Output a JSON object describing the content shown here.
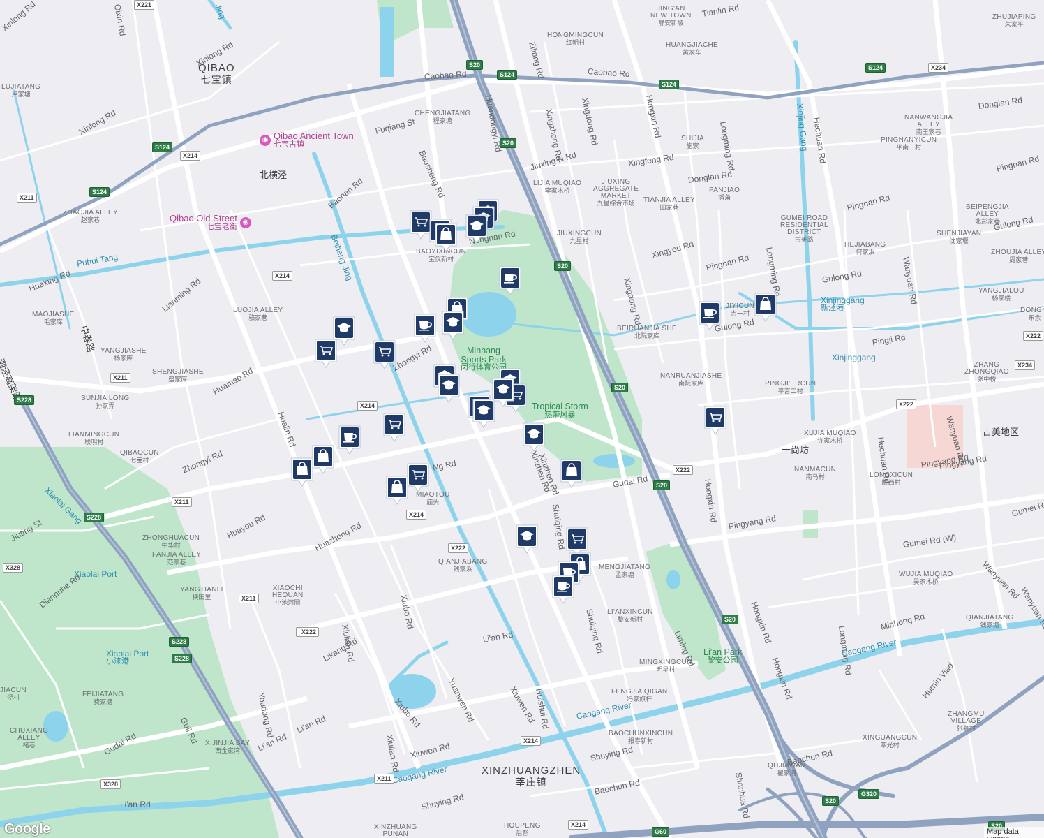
{
  "map": {
    "attribution": "Map data ©2025",
    "logo": "Google",
    "colors": {
      "background": "#eeeef2",
      "water": "#8ed3ec",
      "park": "#bfe6cb",
      "road": "#ffffff",
      "highway": "#8fa3c0",
      "pin": "#1f3a66",
      "poi": "#d65bbf"
    }
  },
  "towns": [
    {
      "id": "qibao",
      "en": "QIBAO",
      "zh": "七宝镇"
    },
    {
      "id": "xinzhuang",
      "en": "XINZHUANGZHEN",
      "zh": "莘庄镇"
    }
  ],
  "places": [
    {
      "id": "jingan",
      "en": "JING'AN",
      "en2": "NEW TOWN",
      "zh": "静安新城"
    },
    {
      "id": "hongmingcun",
      "en": "HONGMINGCUN",
      "zh": "红明村"
    },
    {
      "id": "huangjiache",
      "en": "HUANGJIACHE",
      "zh": "黄家车"
    },
    {
      "id": "zhujiaping",
      "en": "ZHUJIAPING",
      "zh": "朱家平"
    },
    {
      "id": "lujiatang",
      "en": "LUJIATANG",
      "zh": "卢家塘"
    },
    {
      "id": "chengjiatang",
      "en": "CHENGJIATANG",
      "zh": "程家塘"
    },
    {
      "id": "shijia",
      "en": "SHIJIA",
      "zh": "施家"
    },
    {
      "id": "nanwangjia",
      "en": "NANWANGJIA",
      "en2": "ALLEY",
      "zh": "南王家巷"
    },
    {
      "id": "pingnanyicun",
      "en": "PINGNANYICUN",
      "zh": "平南一村"
    },
    {
      "id": "lijiamuqiao",
      "en": "LIJIA MUQIAO",
      "zh": "李家木桥"
    },
    {
      "id": "jiuxingmarket",
      "en": "JIUXING",
      "en2": "AGGREGATE",
      "en3": "MARKET",
      "zh": "九星综合市场"
    },
    {
      "id": "tianjia",
      "en": "TIANJIA ALLEY",
      "zh": "田家巷"
    },
    {
      "id": "panjiao",
      "en": "PANJIAO",
      "zh": "潘角"
    },
    {
      "id": "zhaojia",
      "en": "ZHAOJIA ALLEY",
      "zh": "赵家巷"
    },
    {
      "id": "baoyixincun",
      "en": "BAOYIXINCUN",
      "zh": "宝仪新村"
    },
    {
      "id": "jiuxingcun",
      "en": "JIUXINGCUN",
      "zh": "九星村"
    },
    {
      "id": "gumei",
      "en": "GUMEI ROAD",
      "en2": "RESIDENTIAL",
      "en3": "DISTRICT",
      "zh": "古美路"
    },
    {
      "id": "beipengjia",
      "en": "BEIPENGJIA",
      "en2": "ALLEY",
      "zh": "北彭家巷"
    },
    {
      "id": "shenjiayan",
      "en": "SHENJIAYAN",
      "zh": "沈家堰"
    },
    {
      "id": "hejiabang",
      "en": "HEJIABANG",
      "zh": "何家浜"
    },
    {
      "id": "zhoujia",
      "en": "ZHOUJIA ALLEY",
      "zh": "周家巷"
    },
    {
      "id": "maojiashe",
      "en": "MAOJIASHE",
      "zh": "毛家库"
    },
    {
      "id": "luojia",
      "en": "LUOJIA ALLEY",
      "zh": "骆家巷"
    },
    {
      "id": "yangjialou",
      "en": "YANGJIALOU",
      "zh": "杨家楼"
    },
    {
      "id": "jiyicun",
      "en": "JIYICUN",
      "zh": "吉一村"
    },
    {
      "id": "dongyi",
      "en": "DONGYI",
      "zh": "东余"
    },
    {
      "id": "yangjiashe",
      "en": "YANGJIASHE",
      "zh": "杨家库"
    },
    {
      "id": "beiruanjia",
      "en": "BEIRUANJIA SHE",
      "zh": "北阮家库"
    },
    {
      "id": "shengjiashe",
      "en": "SHENGJIASHE",
      "zh": "盛家库"
    },
    {
      "id": "nanruanjia",
      "en": "NANRUANJIASHE",
      "zh": "南阮家库"
    },
    {
      "id": "pingjiercun",
      "en": "PINGJI'ERCUN",
      "zh": "平吉二村"
    },
    {
      "id": "zhangzhongqiao",
      "en": "ZHANG",
      "en2": "ZHONGQIAO",
      "zh": "张中桥"
    },
    {
      "id": "sunjia",
      "en": "SUNJIA LONG",
      "zh": "孙家弄"
    },
    {
      "id": "lianmingcun",
      "en": "LIANMINGCUN",
      "zh": "联明村"
    },
    {
      "id": "xujiamuqiao",
      "en": "XUJIA MUQIAO",
      "zh": "许家木桥"
    },
    {
      "id": "qibaocun",
      "en": "QIBAOCUN",
      "zh": "七宝村"
    },
    {
      "id": "nanmacun",
      "en": "NANMACUN",
      "zh": "南马村"
    },
    {
      "id": "longxicun",
      "en": "LONGXICUN",
      "zh": "陇西村"
    },
    {
      "id": "miaotou",
      "en": "MIAOTOU",
      "zh": "庙头"
    },
    {
      "id": "zhonghuacun",
      "en": "ZHONGHUACUN",
      "zh": "中华村"
    },
    {
      "id": "fanjia",
      "en": "FANJIA ALLEY",
      "zh": "范家巷"
    },
    {
      "id": "qianjiabang",
      "en": "QIANJIABANG",
      "zh": "钱家浜"
    },
    {
      "id": "mengjiatang",
      "en": "MENGJIATANG",
      "zh": "孟家塘"
    },
    {
      "id": "wujiamuqiao",
      "en": "WUJIA MUQIAO",
      "zh": "吴家木桥"
    },
    {
      "id": "yangtianli",
      "en": "YANGTIANLI",
      "zh": "秧田里"
    },
    {
      "id": "xiaochi",
      "en": "XIAOCHI",
      "en2": "HEQUAN",
      "zh": "小池河圈"
    },
    {
      "id": "lianxincun",
      "en": "LI'ANXINCUN",
      "zh": "黎安新村"
    },
    {
      "id": "qianjiatang",
      "en": "QIANJIATANG",
      "zh": "钱家塘"
    },
    {
      "id": "mingxingcun",
      "en": "MINGXINGCUN",
      "zh": "明星村"
    },
    {
      "id": "fengjia",
      "en": "FENGJIA QIGAN",
      "zh": "冯家旗杆"
    },
    {
      "id": "xinjiacun",
      "en": "JIACUN",
      "zh": "泾村"
    },
    {
      "id": "feijiatang",
      "en": "FEIJIATANG",
      "zh": "费家塘"
    },
    {
      "id": "zhangmu",
      "en": "ZHANGMU",
      "en2": "VILLAGE",
      "zh": "张慕村"
    },
    {
      "id": "chuxiang",
      "en": "CHUXIANG",
      "en2": "ALLEY",
      "zh": "褚巷"
    },
    {
      "id": "xijinjia",
      "en": "XIJINJIA BAY",
      "zh": "西金家湾"
    },
    {
      "id": "baochuncun",
      "en": "BAOCHUNXINCUN",
      "zh": "报春新村"
    },
    {
      "id": "xinguangcun",
      "en": "XINGUANGCUN",
      "zh": "莘光村"
    },
    {
      "id": "qujiawan",
      "en": "QUJIAWAN",
      "zh": "瞿家湾"
    },
    {
      "id": "houpeng",
      "en": "HOUPENG",
      "zh": "后彭"
    },
    {
      "id": "xinzhuangpunan",
      "en": "XINZHUANG",
      "en2": "PUNAN",
      "zh": ""
    }
  ],
  "roads": {
    "r1": "Xinlong Rd",
    "r2": "Xinlong Rd",
    "r3": "Xinlong Rd",
    "r4": "Qixin Rd",
    "r5": "Caobao Rd",
    "r6": "Caobao Rd",
    "r7": "Tianlin Rd",
    "r8": "Ziliang Rd",
    "r9": "Huandongyi Rd",
    "r10": "Xingzhong Rd",
    "r11": "Xingdong Rd",
    "r12": "Hongxin Rd",
    "r13": "Longming Rd",
    "r14": "Hechuan Rd",
    "r15": "Donglan Rd",
    "r16": "Jiuxing N Rd",
    "r17": "Xingfeng Rd",
    "r18": "Donglan Rd",
    "r19": "Pingnan Rd",
    "r20": "Pingnan Rd",
    "r21": "Fuqiang St",
    "r22": "Baosheng Rd",
    "r23": "Baonan Rd",
    "r24": "Nongnan Rd",
    "r25": "Gulong Rd",
    "r26": "Xingyou Rd",
    "r27": "Pingnan Rd",
    "r28": "Wanyuan Rd",
    "r29": "Gulong Rd",
    "r30": "Huaxing Rd",
    "r31": "Lianming Rd",
    "r32": "Xingdong Rd",
    "r33": "Gulong Rd",
    "r34": "Pingji Rd",
    "r35": "Zhongyi Rd",
    "r36": "Huamao Rd",
    "r37": "Hualin Rd",
    "r38": "Zhongyi Rd",
    "r39": "Huayou Rd",
    "r40": "Huazhong Rd",
    "r41": "Gudai Rd",
    "r42": "Shuiqing Rd",
    "r43": "Xinzhen Rd",
    "r44": "Hongxin Rd",
    "r45": "Pingyang Rd",
    "r46": "Pingyang Rd",
    "r47": "Gumei Rd (W)",
    "r48": "Gumei Rd",
    "r49": "Wanyuan Rd",
    "r50": "Wanyuan Rd",
    "r51": "Hechuan Rd",
    "r52": "Jiuting St",
    "r53": "Dianpuhe Rd",
    "r54": "Xiubo Rd",
    "r55": "Xiulian Rd",
    "r56": "Likang Rd",
    "r57": "Li'an Rd",
    "r58": "Shuiqing Rd",
    "r59": "Liming Rd",
    "r60": "Hongxin Rd",
    "r61": "Minhong Rd",
    "r62": "Longming Rd",
    "r63": "Xiuwen Rd",
    "r64": "Huishui Rd",
    "r65": "Yuanwen Rd",
    "r66": "Xiubo Rd",
    "r67": "Xiulian Rd",
    "r68": "Xiuwen Rd",
    "r69": "Youdong Rd",
    "r70": "Li'an Rd",
    "r71": "Li'an Rd",
    "r72": "Gudai Rd",
    "r73": "Guli Rd",
    "r74": "Shuying Rd",
    "r75": "Baochun Rd",
    "r76": "Shanhua Rd",
    "r77": "Baochun Rd",
    "r78": "Shuying Rd",
    "r79": "Li'an Rd",
    "r80": "Humin Viad",
    "r81": "Wanyuan Rd",
    "r82": "Pingyang Rd",
    "r83": "Longming Rd",
    "r84": "Dong",
    "r85": "Hongxin Rd",
    "r86": "Ng Rd",
    "r87": "Xinzhen Rd"
  },
  "waters": [
    {
      "id": "puhui",
      "en": "Puhui Tang",
      "zh": ""
    },
    {
      "id": "beiheng",
      "en": "Beiheng Jing",
      "zh": ""
    },
    {
      "id": "xinjing",
      "en": "Xinjing Gang",
      "zh": ""
    },
    {
      "id": "xinjinggang",
      "en": "Xinjinggang",
      "zh": "新泾港"
    },
    {
      "id": "xinjinggang2",
      "en": "Xinjinggang",
      "zh": ""
    },
    {
      "id": "xiaolaigang",
      "en": "Xiaolai Gang",
      "zh": ""
    },
    {
      "id": "xiaolaiport",
      "en": "Xiaolai Port",
      "zh": ""
    },
    {
      "id": "xiaolaiport2",
      "en": "Xiaolai Port",
      "zh": "小涞港"
    },
    {
      "id": "caogang1",
      "en": "Caogang River",
      "zh": ""
    },
    {
      "id": "caogang2",
      "en": "Caogang River",
      "zh": ""
    },
    {
      "id": "caogang3",
      "en": "Caogang River",
      "zh": ""
    },
    {
      "id": "beihengjing_top",
      "en": "Jing",
      "zh": ""
    }
  ],
  "parks": [
    {
      "id": "minhang",
      "en": "Minhang",
      "en2": "Sports Park",
      "zh": "闵行体育公园"
    },
    {
      "id": "lian",
      "en": "Li'an Park",
      "zh": "黎安公园"
    },
    {
      "id": "tropical",
      "en": "Tropical Storm",
      "zh": "热带风暴"
    }
  ],
  "pois": [
    {
      "id": "qibaoancient",
      "en": "Qibao Ancient Town",
      "zh": "七宝古镇",
      "icon": "camera-icon"
    },
    {
      "id": "qibaoold",
      "en": "Qibao Old Street",
      "zh": "七宝老街",
      "icon": "camera-icon"
    }
  ],
  "other_labels": {
    "beihengjing_zh": "北横泾",
    "shishangfang": "十尚坊",
    "gumeidiqu": "古美地区",
    "zhongchunlu": "中春路",
    "chengjiaqiao": "泗泾高架路",
    "lianxincun_x": "JIACUN"
  },
  "shields": {
    "s1": "X221",
    "s2": "S20",
    "s3": "S124",
    "s4": "S124",
    "s5": "S124",
    "s6": "X234",
    "s7": "S20",
    "s8": "S124",
    "s9": "X214",
    "s10": "S124",
    "s11": "X211",
    "s12": "S20",
    "s13": "X214",
    "s14": "S20",
    "s15": "X211",
    "s16": "S228",
    "s17": "X214",
    "s18": "X222",
    "s19": "X234",
    "s20": "X222",
    "s21": "X211",
    "s22": "S228",
    "s23": "X214",
    "s24": "S20",
    "s25": "X222",
    "s26": "X328",
    "s27": "X211",
    "s28": "X222",
    "s29": "X211",
    "s30": "S20",
    "s31": "S228",
    "s32": "S228",
    "s33": "X214",
    "s34": "X328",
    "s35": "X211",
    "s36": "S20",
    "s37": "G320",
    "s38": "X214",
    "s39": "G60",
    "s40": "S20",
    "s41": "X222"
  },
  "pins": [
    {
      "type": "shopping",
      "label": "Supermarket"
    },
    {
      "type": "shopping",
      "label": "Supermarket"
    },
    {
      "type": "school",
      "label": "School"
    },
    {
      "type": "school",
      "label": "School"
    },
    {
      "type": "bag",
      "label": "Store"
    },
    {
      "type": "school",
      "label": "School"
    },
    {
      "type": "cafe",
      "label": "Cafe"
    },
    {
      "type": "bag",
      "label": "Store"
    },
    {
      "type": "school",
      "label": "School"
    },
    {
      "type": "cafe",
      "label": "Cafe"
    },
    {
      "type": "school",
      "label": "School"
    },
    {
      "type": "shopping",
      "label": "Supermarket"
    },
    {
      "type": "shopping",
      "label": "Supermarket"
    },
    {
      "type": "school",
      "label": "School"
    },
    {
      "type": "school",
      "label": "School"
    },
    {
      "type": "school",
      "label": "School"
    },
    {
      "type": "shopping",
      "label": "Supermarket"
    },
    {
      "type": "school",
      "label": "School"
    },
    {
      "type": "school",
      "label": "School"
    },
    {
      "type": "school",
      "label": "School"
    },
    {
      "type": "shopping",
      "label": "Supermarket"
    },
    {
      "type": "cafe",
      "label": "Cafe"
    },
    {
      "type": "bag",
      "label": "Store"
    },
    {
      "type": "bag",
      "label": "Store"
    },
    {
      "type": "shopping",
      "label": "Supermarket"
    },
    {
      "type": "bag",
      "label": "Store"
    },
    {
      "type": "school",
      "label": "School"
    },
    {
      "type": "bag",
      "label": "Store"
    },
    {
      "type": "school",
      "label": "School"
    },
    {
      "type": "shopping",
      "label": "Supermarket"
    },
    {
      "type": "bag",
      "label": "Store"
    },
    {
      "type": "cafe",
      "label": "Cafe"
    },
    {
      "type": "cafe",
      "label": "Cafe"
    },
    {
      "type": "bag",
      "label": "Store"
    },
    {
      "type": "cafe",
      "label": "Cafe"
    },
    {
      "type": "shopping",
      "label": "Supermarket"
    }
  ]
}
